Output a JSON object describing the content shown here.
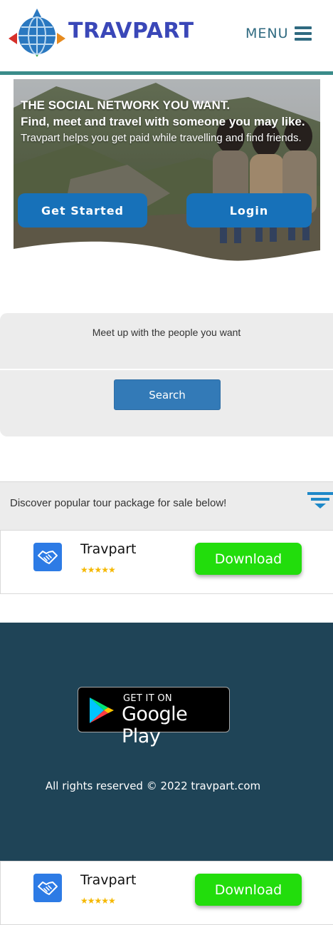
{
  "header": {
    "brand": "TRAVPART",
    "menu_label": "MENU",
    "icons": {
      "logo": "globe-logo-icon",
      "menu": "hamburger-icon"
    },
    "colors": {
      "brand": "#3a47b8",
      "menu": "#2f6a80",
      "rule": "#3a8c8a"
    }
  },
  "hero": {
    "kicker": "THE SOCIAL NETWORK YOU WANT.",
    "title": "Find, meet and travel with someone you may like.",
    "subtitle": "Travpart helps you get paid while travelling and find friends.",
    "get_started_label": "Get Started",
    "login_label": "Login",
    "button_color": "#1771b9"
  },
  "search": {
    "caption": "Meet up with the people you want",
    "button_label": "Search",
    "button_color": "#337ab7"
  },
  "discover": {
    "text": "Discover popular tour package for sale below!",
    "icon": "filter-icon"
  },
  "app_banner": {
    "name": "Travpart",
    "rating_stars": "★★★★★",
    "rating_value": 5,
    "download_label": "Download",
    "icon": "handshake-icon",
    "download_color": "#22dd0c"
  },
  "footer": {
    "store_small": "GET IT ON",
    "store_big": "Google Play",
    "copyright": "All rights reserved © 2022 travpart.com",
    "background": "#1f4457"
  }
}
